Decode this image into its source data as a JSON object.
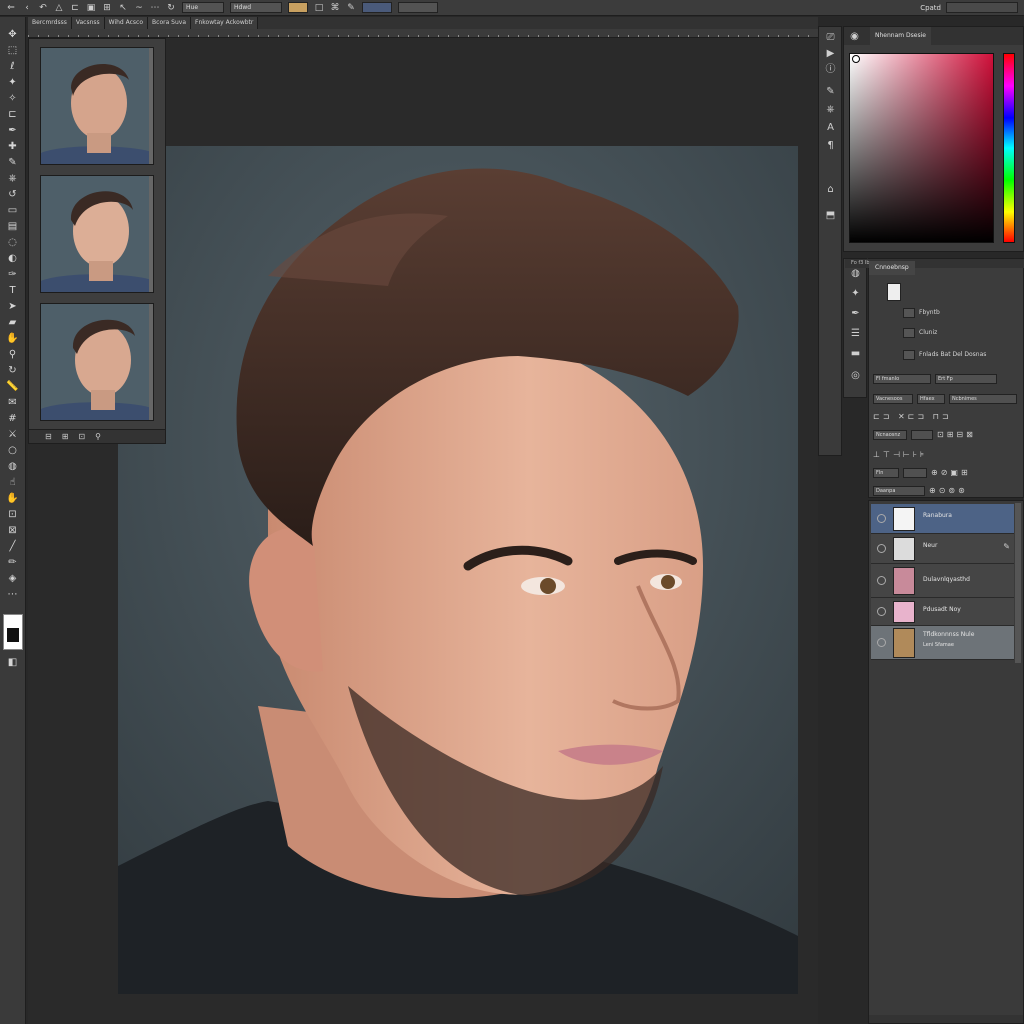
{
  "topbar": {
    "field_1": "Hue",
    "field_2": "Hdwd",
    "right_label": "Cpatd"
  },
  "tabs": [
    "Bercmrdsss",
    "Vacsnss",
    "Wihd Acsco",
    "Bcora Suva",
    "Fnkowtay Ackowbtr"
  ],
  "color_panel": {
    "tab_label": "Nhennam Dsesie",
    "accent_color": "#d0103a"
  },
  "properties": {
    "tabs_label": "Fo   f3   Ibnummon",
    "title": "Cnnoebnsp",
    "row_1_label": "Fbyntb",
    "row_2_label": "Cluniz",
    "row_3_label": "Fnlads Bat Del Dosnas",
    "field_a": "Fl fmanlo",
    "field_b": "Ert Fp",
    "field_c": "Vacnesoos",
    "field_d": "Hfaex",
    "field_e": "Ncbnimes",
    "field_f": "Ncnaosnz",
    "field_g": "Fln",
    "field_h": "Daanpa"
  },
  "layers": [
    {
      "name": "Ranabura",
      "name2": "",
      "thumb": "#f4f4f4",
      "state": "selected"
    },
    {
      "name": "Neur",
      "name2": "",
      "thumb": "#dcdcdc",
      "state": "normal"
    },
    {
      "name": "Dulavnlqyasthd",
      "name2": "",
      "thumb": "#c88a9a",
      "state": "normal"
    },
    {
      "name": "Pdusadt Noy",
      "name2": "",
      "thumb": "#e8b3cc",
      "state": "normal"
    },
    {
      "name": "Tfldkonnnss Nule",
      "name2": "Leni  Sfamae",
      "thumb": "#b08a5a",
      "state": "highlight"
    }
  ]
}
